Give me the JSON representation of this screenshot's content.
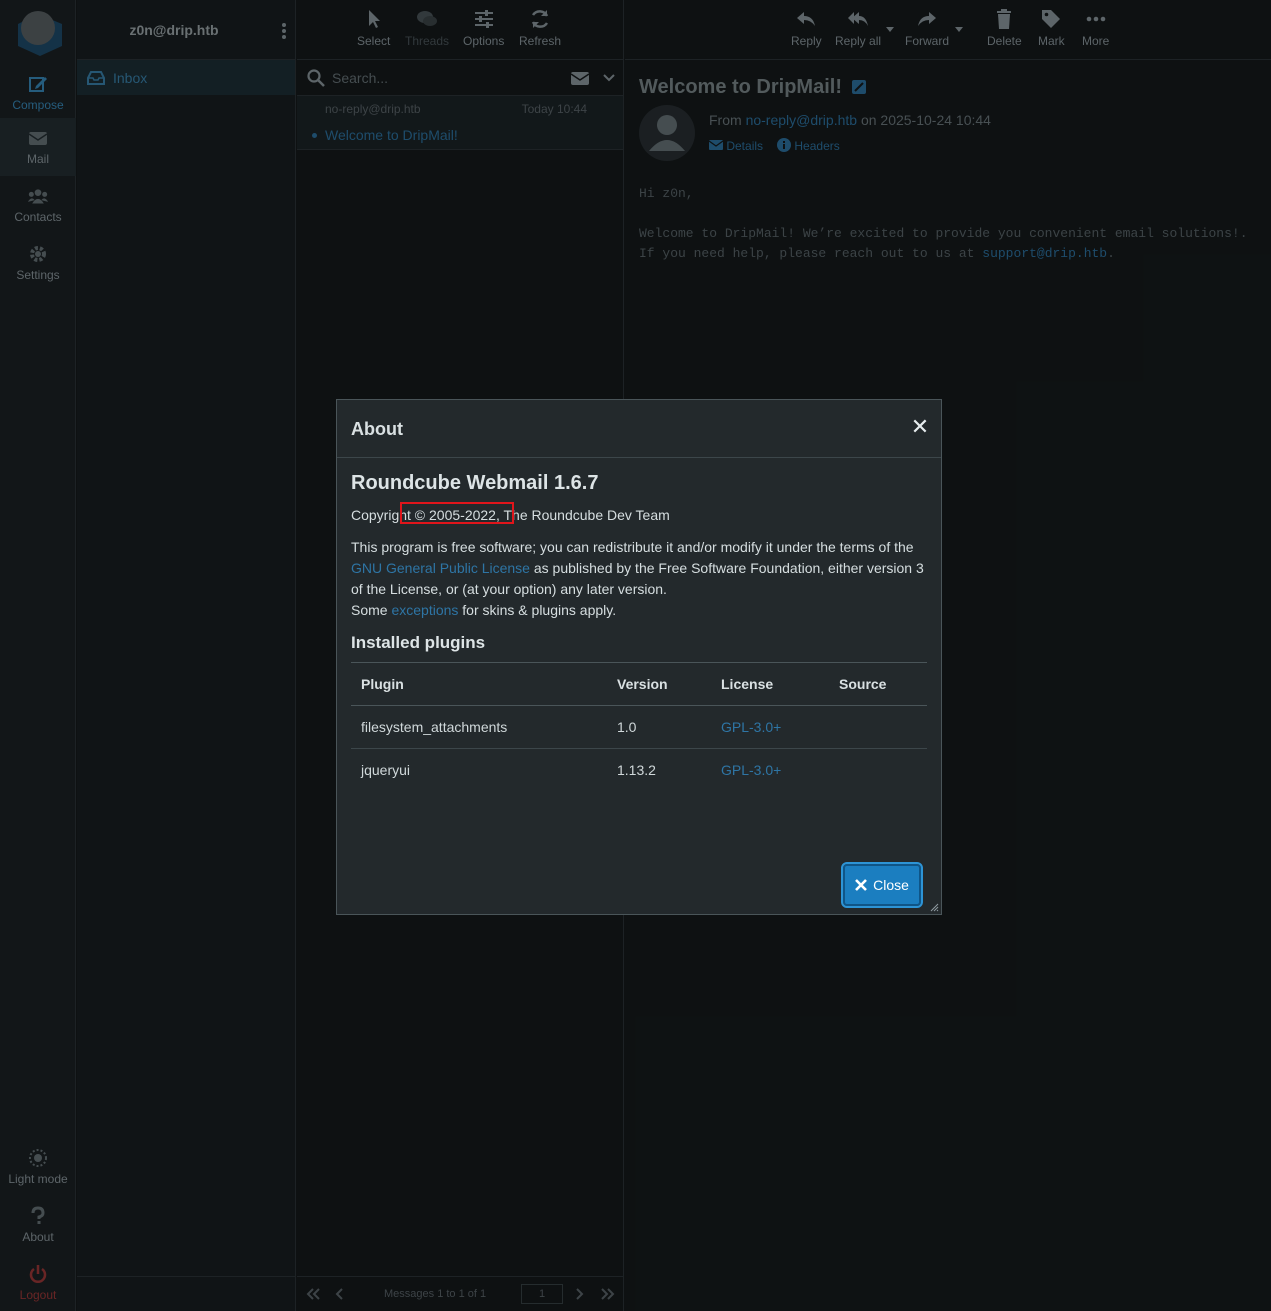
{
  "nav": {
    "compose": "Compose",
    "mail": "Mail",
    "contacts": "Contacts",
    "settings": "Settings",
    "light_mode": "Light mode",
    "about": "About",
    "logout": "Logout"
  },
  "account": "z0n@drip.htb",
  "folders": [
    {
      "label": "Inbox"
    }
  ],
  "list_toolbar": {
    "select": "Select",
    "threads": "Threads",
    "options": "Options",
    "refresh": "Refresh"
  },
  "search": {
    "placeholder": "Search..."
  },
  "messages": [
    {
      "from": "no-reply@drip.htb",
      "date": "Today 10:44",
      "subject": "Welcome to DripMail!"
    }
  ],
  "pager": {
    "text": "Messages 1 to 1 of 1",
    "page": "1"
  },
  "mail_toolbar": {
    "reply": "Reply",
    "reply_all": "Reply all",
    "forward": "Forward",
    "delete": "Delete",
    "mark": "Mark",
    "more": "More"
  },
  "mail": {
    "title": "Welcome to DripMail!",
    "from_prefix": "From",
    "from_addr": "no-reply@drip.htb",
    "on_date": "on 2025-10-24 10:44",
    "details": "Details",
    "headers": "Headers",
    "greeting": "Hi z0n,",
    "line1": "Welcome to DripMail! We’re excited to provide you convenient email solutions!.",
    "line2_prefix": "If you need help, please reach out to us at",
    "support": "support@drip.htb",
    "line2_suffix": "."
  },
  "about_dialog": {
    "title": "About",
    "heading": "Roundcube Webmail 1.6.7",
    "copyright": "Copyright © 2005-2022, The Roundcube Dev Team",
    "license_p1": "This program is free software; you can redistribute it and/or modify it under the terms of the",
    "license_link": "GNU General Public License",
    "license_p2": "as published by the Free Software Foundation, either version 3 of the License, or (at your option) any later version.",
    "some": "Some",
    "exceptions": "exceptions",
    "exceptions_rest": "for skins & plugins apply.",
    "plugins_heading": "Installed plugins",
    "columns": [
      "Plugin",
      "Version",
      "License",
      "Source"
    ],
    "plugins": [
      {
        "name": "filesystem_attachments",
        "version": "1.0",
        "license": "GPL-3.0+",
        "source": ""
      },
      {
        "name": "jqueryui",
        "version": "1.13.2",
        "license": "GPL-3.0+",
        "source": ""
      }
    ],
    "close": "Close"
  }
}
